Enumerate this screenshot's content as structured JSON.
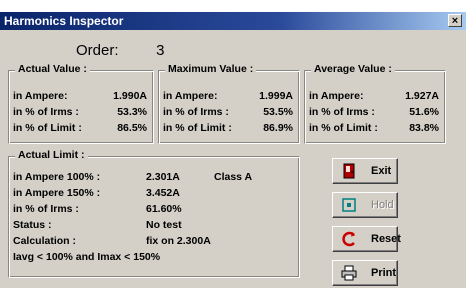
{
  "window": {
    "title": "Harmonics Inspector",
    "close_label": "×"
  },
  "order": {
    "label": "Order:",
    "value": "3"
  },
  "actual": {
    "title": "Actual Value :",
    "rows": [
      {
        "label": "in Ampere:",
        "value": "1.990A"
      },
      {
        "label": "in % of Irms :",
        "value": "53.3%"
      },
      {
        "label": "in % of Limit :",
        "value": "86.5%"
      }
    ]
  },
  "maximum": {
    "title": "Maximum Value :",
    "rows": [
      {
        "label": "in Ampere:",
        "value": "1.999A"
      },
      {
        "label": "in % of Irms :",
        "value": "53.5%"
      },
      {
        "label": "in % of Limit :",
        "value": "86.9%"
      }
    ]
  },
  "average": {
    "title": "Average Value :",
    "rows": [
      {
        "label": "in Ampere:",
        "value": "1.927A"
      },
      {
        "label": "in % of Irms :",
        "value": "51.6%"
      },
      {
        "label": "in % of Limit :",
        "value": "83.8%"
      }
    ]
  },
  "limit": {
    "title": "Actual Limit :",
    "rows": [
      {
        "label": "in Ampere 100% :",
        "value": "2.301A",
        "extra": "Class A"
      },
      {
        "label": "in Ampere 150% :",
        "value": "3.452A"
      },
      {
        "label": "in % of Irms :",
        "value": "61.60%"
      },
      {
        "label": "Status :",
        "value": "No test"
      },
      {
        "label": "Calculation :",
        "value": "fix on  2.300A"
      }
    ],
    "note": "Iavg < 100% and Imax < 150%"
  },
  "buttons": {
    "exit": "Exit",
    "hold": "Hold",
    "reset": "Reset",
    "print": "Print"
  },
  "colors": {
    "title_bar": "#0a246a",
    "face": "#d4d0c8",
    "reset_icon": "#cc0000",
    "exit_icon": "#b00000"
  }
}
